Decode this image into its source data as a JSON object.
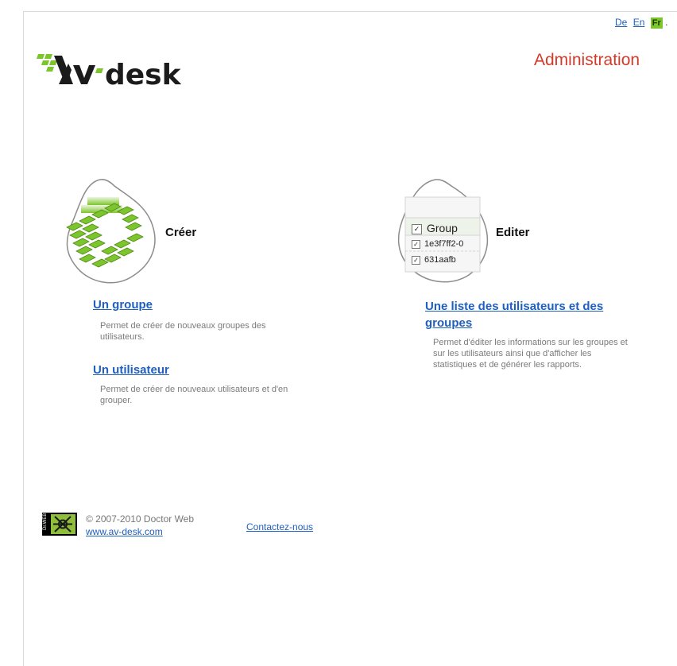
{
  "languages": [
    {
      "code": "De",
      "active": false
    },
    {
      "code": "En",
      "active": false
    },
    {
      "code": "Fr",
      "active": true
    }
  ],
  "lang_separator": ".",
  "logo_text": "Av-desk",
  "header": {
    "title": "Administration"
  },
  "create": {
    "title": "Créer",
    "items": [
      {
        "link": "Un groupe",
        "description": "Permet de créer de nouveaux groupes des utilisateurs."
      },
      {
        "link": "Un utilisateur",
        "description": "Permet de créer de nouveaux utilisateurs et d'en grouper."
      }
    ]
  },
  "edit": {
    "title": "Editer",
    "illustration": {
      "header": "Group",
      "rows": [
        "1e3f7ff2-0",
        "631aafb"
      ]
    },
    "link_lines": [
      "Une liste des utilisateurs et des",
      "groupes"
    ],
    "description": "Permet d'éditer les informations sur les groupes et sur les utilisateurs ainsi que d'afficher les statistiques et de générer les rapports."
  },
  "footer": {
    "badge": "Dr.WEB",
    "copyright": "© 2007-2010 Doctor Web",
    "site_link": "www.av-desk.com",
    "contact_link": "Contactez-nous"
  },
  "colors": {
    "link": "#1f5fbf",
    "accent_red": "#d33a2a",
    "brand_green": "#7dc52c",
    "muted_text": "#7b7b7b"
  }
}
